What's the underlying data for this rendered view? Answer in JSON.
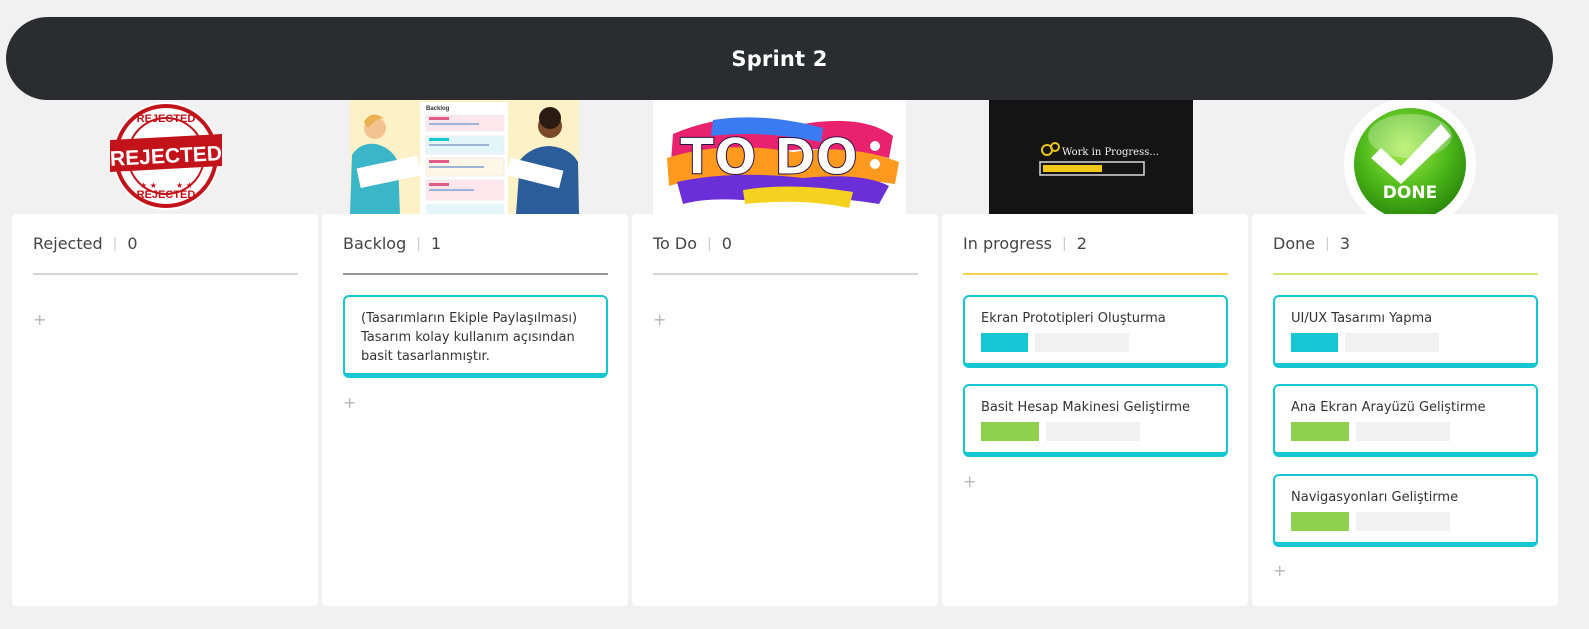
{
  "sprint_title": "Sprint 2",
  "header_images": {
    "rejected": {
      "ring_top": "REJECTED",
      "ring_bottom": "REJECTED",
      "banner": "REJECTED"
    },
    "backlog": {
      "doc_title": "Backlog"
    },
    "todo": {
      "text": "TO DO"
    },
    "wip": {
      "text": "Work in Progress...",
      "progress_fraction": 0.6
    },
    "done": {
      "text": "DONE"
    }
  },
  "columns": [
    {
      "name": "Rejected",
      "count": "0",
      "line_color": "#d5d5d5",
      "cards": []
    },
    {
      "name": "Backlog",
      "count": "1",
      "line_color": "#999999",
      "cards": [
        {
          "title": "(Tasarımların Ekiple Paylaşılması) Tasarım kolay kullanım açısından basit tasarlanmıştır."
        }
      ]
    },
    {
      "name": "To Do",
      "count": "0",
      "line_color": "#d5d5d5",
      "cards": []
    },
    {
      "name": "In progress",
      "count": "2",
      "line_color": "#f2d34f",
      "cards": [
        {
          "title": "Ekran Prototipleri Oluşturma",
          "tag_color": "#17c6d3"
        },
        {
          "title": "Basit Hesap Makinesi Geliştirme",
          "tag_color": "#8fd14f"
        }
      ]
    },
    {
      "name": "Done",
      "count": "3",
      "line_color": "#d7e46d",
      "cards": [
        {
          "title": "UI/UX Tasarımı Yapma",
          "tag_color": "#17c6d3"
        },
        {
          "title": "Ana Ekran Arayüzü Geliştirme",
          "tag_color": "#8fd14f"
        },
        {
          "title": "Navigasyonları Geliştirme",
          "tag_color": "#8fd14f"
        }
      ]
    }
  ],
  "add_symbol": "+",
  "count_separator": "|"
}
